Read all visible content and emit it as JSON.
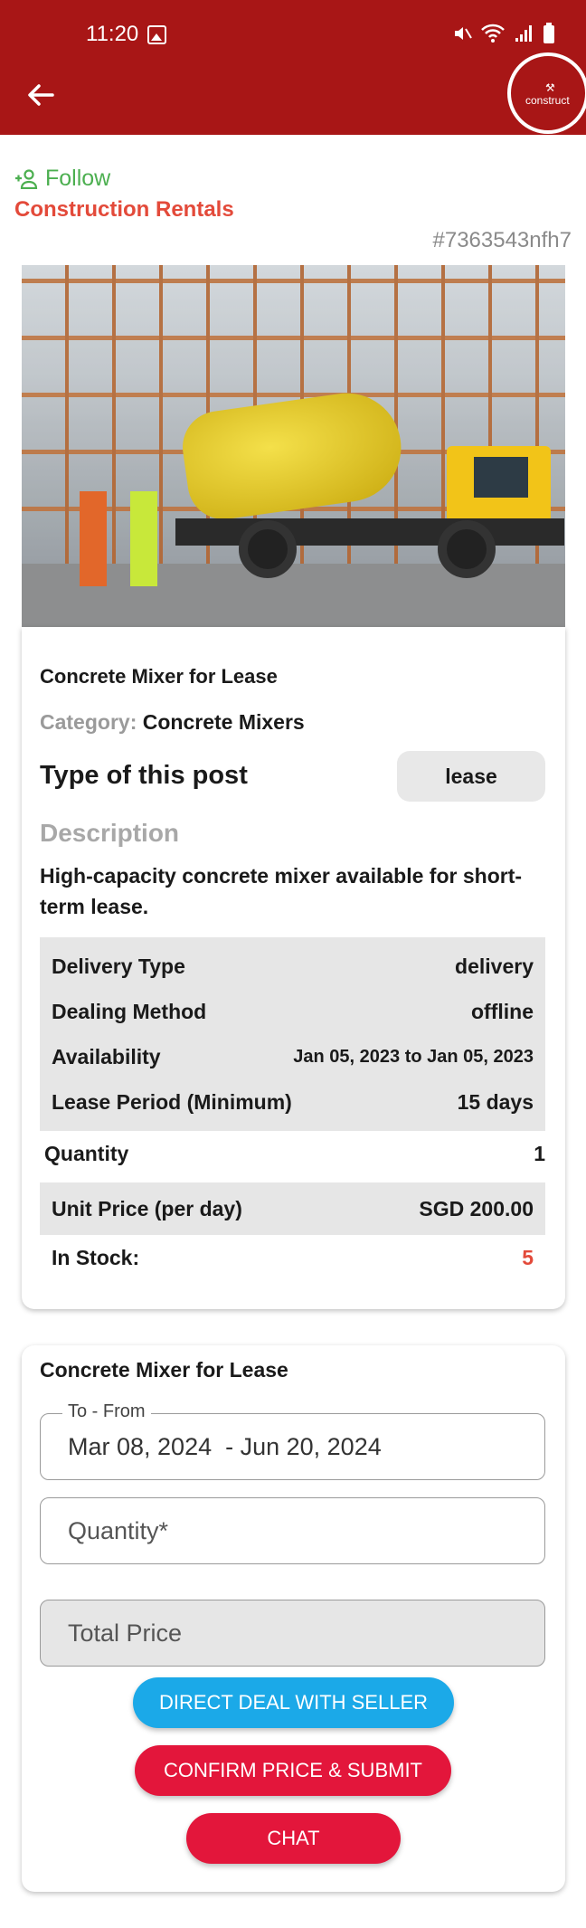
{
  "status_bar": {
    "time": "11:20"
  },
  "appbar": {
    "logo_text": "construct"
  },
  "seller": {
    "follow_label": "Follow",
    "name": "Construction Rentals",
    "post_id": "#7363543nfh7"
  },
  "listing": {
    "title": "Concrete Mixer for Lease",
    "category_label": "Category:",
    "category_value": "Concrete Mixers",
    "type_heading": "Type of this post",
    "type_value": "lease",
    "description_heading": "Description",
    "description": "High-capacity concrete mixer available for short-term lease.",
    "details": [
      {
        "label": "Delivery Type",
        "value": "delivery"
      },
      {
        "label": "Dealing Method",
        "value": "offline"
      },
      {
        "label": "Availability",
        "value": "Jan 05, 2023 to Jan 05, 2023"
      },
      {
        "label": "Lease Period (Minimum)",
        "value": "15 days"
      }
    ],
    "quantity": {
      "label": "Quantity",
      "value": "1"
    },
    "unit_price": {
      "label": "Unit Price (per day)",
      "value": "SGD 200.00"
    },
    "stock": {
      "label": "In Stock:",
      "value": "5"
    }
  },
  "order_form": {
    "title": "Concrete Mixer for Lease",
    "date_label": "To - From",
    "date_value": "Mar 08, 2024  - Jun 20, 2024",
    "quantity_placeholder": "Quantity*",
    "total_placeholder": "Total Price",
    "direct_deal_label": "DIRECT DEAL WITH SELLER",
    "confirm_label": "CONFIRM PRICE & SUBMIT",
    "chat_label": "CHAT"
  },
  "colors": {
    "appbar": "#a81616",
    "follow": "#4caf50",
    "seller": "#e34a3a",
    "direct_button": "#1ba9e8",
    "primary_button": "#e3163b"
  }
}
